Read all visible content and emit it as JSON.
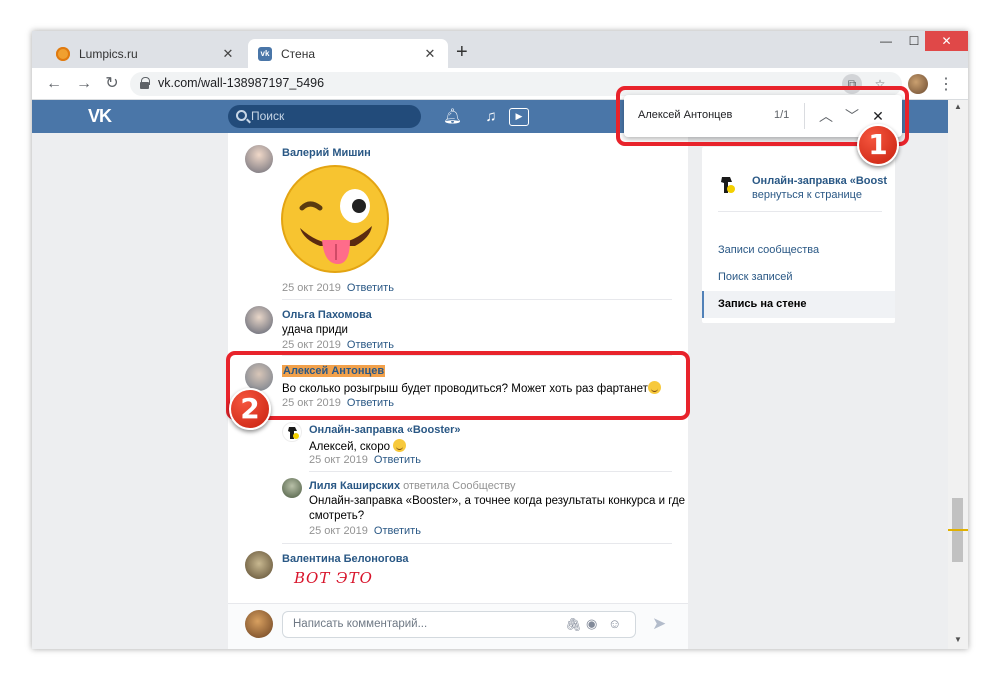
{
  "browser": {
    "tabs": [
      {
        "title": "Lumpics.ru"
      },
      {
        "title": "Стена"
      }
    ],
    "url": "vk.com/wall-138987197_5496"
  },
  "vk_header": {
    "logo": "VK",
    "search_placeholder": "Поиск"
  },
  "find_bar": {
    "query": "Алексей Антонцев",
    "count": "1/1"
  },
  "comments": [
    {
      "author": "Валерий Мишин",
      "date": "25 окт 2019",
      "reply": "Ответить"
    },
    {
      "author": "Ольга Пахомова",
      "text": "удача приди",
      "date": "25 окт 2019",
      "reply": "Ответить"
    },
    {
      "author": "Алексей Антонцев",
      "text": "Во сколько розыгрыш будет проводиться? Может хоть раз фартанет",
      "date": "25 окт 2019",
      "reply": "Ответить"
    },
    {
      "author": "Онлайн-заправка «Booster»",
      "text": "Алексей, скоро",
      "date": "25 окт 2019",
      "reply": "Ответить"
    },
    {
      "author": "Лиля Каширских",
      "replied_to": "ответила Сообществу",
      "text_line1": "Онлайн-заправка «Booster», а точнее когда результаты конкурса и где",
      "text_line2": "смотреть?",
      "date": "25 окт 2019",
      "reply": "Ответить"
    },
    {
      "author": "Валентина Белоногова",
      "handwritten": "ВОТ ЭТО"
    }
  ],
  "comment_input": {
    "placeholder": "Написать комментарий..."
  },
  "sidebar": {
    "group_name": "Онлайн-заправка «Boost",
    "back_link": "вернуться к странице",
    "items": [
      {
        "label": "Записи сообщества"
      },
      {
        "label": "Поиск записей"
      },
      {
        "label": "Запись на стене"
      }
    ]
  },
  "annotations": {
    "badge1": "1",
    "badge2": "2"
  },
  "colors": {
    "vk_blue": "#4a76a8",
    "link": "#2a5885",
    "highlight": "#f2a14b",
    "annotation_red": "#e8232b"
  }
}
